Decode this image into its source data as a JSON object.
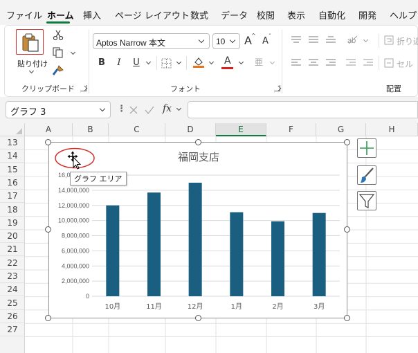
{
  "menu": {
    "tabs": [
      "ファイル",
      "ホーム",
      "挿入",
      "ページ レイアウト",
      "数式",
      "データ",
      "校閲",
      "表示",
      "自動化",
      "開発",
      "ヘルプ"
    ],
    "active": "ホーム"
  },
  "ribbon": {
    "clipboard": {
      "paste_label": "貼り付け",
      "group_label": "クリップボード"
    },
    "font": {
      "font_name": "Aptos Narrow 本文",
      "font_size": "10",
      "bold": "B",
      "italic": "I",
      "underline": "U",
      "increase_size": "A",
      "decrease_size": "A",
      "font_color_letter": "A",
      "phonetic": "亜",
      "group_label": "フォント"
    },
    "alignment": {
      "wrap_label": "折り返",
      "merge_label": "セル",
      "group_label": "配置"
    }
  },
  "formula_bar": {
    "name_box": "グラフ 3",
    "fx": "fx",
    "value": ""
  },
  "grid": {
    "columns": [
      "A",
      "B",
      "C",
      "D",
      "E",
      "F",
      "G",
      "H"
    ],
    "selected_column": "E",
    "rows": [
      "13",
      "14",
      "15",
      "16",
      "17",
      "18",
      "19",
      "20",
      "21",
      "22",
      "23",
      "24",
      "25",
      "26",
      "27"
    ]
  },
  "tooltip": "グラフ エリア",
  "colors": {
    "bar": "#1a5f80",
    "accent_green": "#117a3f",
    "highlight_red": "#d0312d"
  },
  "chart_data": {
    "type": "bar",
    "title": "福岡支店",
    "categories": [
      "10月",
      "11月",
      "12月",
      "1月",
      "2月",
      "3月"
    ],
    "values": [
      12000000,
      13700000,
      15000000,
      11100000,
      9900000,
      11000000
    ],
    "yticks": [
      "16,000,000",
      "14,000,000",
      "12,000,000",
      "10,000,000",
      "8,000,000",
      "6,000,000",
      "4,000,000",
      "2,000,000",
      "0"
    ],
    "ylim": [
      0,
      16000000
    ],
    "grid": true
  }
}
